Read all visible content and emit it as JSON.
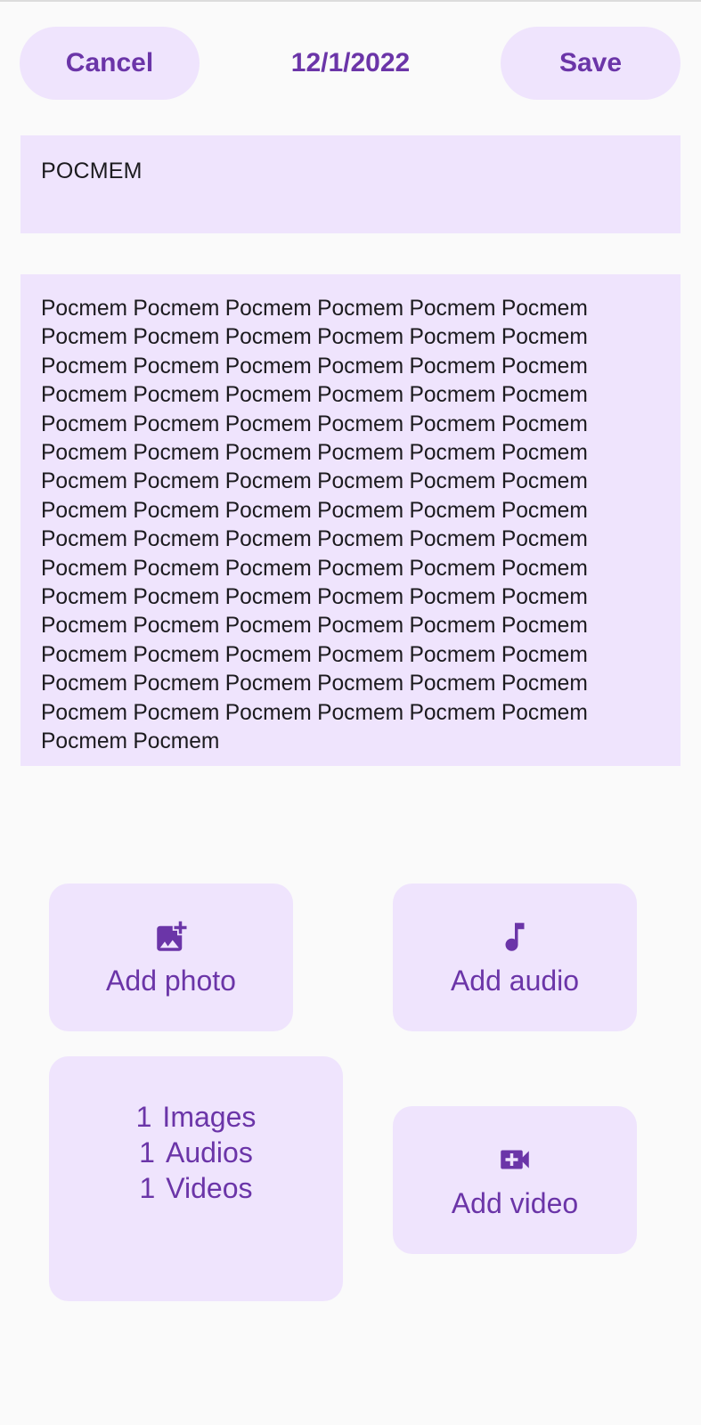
{
  "header": {
    "cancel_label": "Cancel",
    "date": "12/1/2022",
    "save_label": "Save"
  },
  "note": {
    "title": "POCMEM",
    "body_lines": [
      "Pocmem Pocmem Pocmem Pocmem Pocmem Pocmem",
      "Pocmem Pocmem Pocmem Pocmem Pocmem Pocmem",
      "Pocmem Pocmem Pocmem Pocmem Pocmem Pocmem",
      "Pocmem Pocmem Pocmem Pocmem Pocmem Pocmem",
      "Pocmem Pocmem Pocmem Pocmem Pocmem Pocmem",
      "Pocmem Pocmem Pocmem Pocmem Pocmem Pocmem",
      "Pocmem Pocmem Pocmem Pocmem Pocmem Pocmem",
      "Pocmem Pocmem Pocmem Pocmem Pocmem Pocmem",
      "Pocmem Pocmem Pocmem Pocmem Pocmem Pocmem",
      "Pocmem Pocmem Pocmem Pocmem Pocmem Pocmem",
      "Pocmem Pocmem Pocmem Pocmem Pocmem Pocmem",
      "Pocmem Pocmem Pocmem Pocmem Pocmem Pocmem",
      "Pocmem Pocmem Pocmem Pocmem Pocmem Pocmem",
      "Pocmem Pocmem Pocmem Pocmem Pocmem Pocmem",
      "Pocmem Pocmem Pocmem Pocmem Pocmem Pocmem",
      "Pocmem Pocmem"
    ]
  },
  "actions": {
    "add_photo": {
      "label": "Add photo",
      "icon": "add-photo-icon"
    },
    "add_audio": {
      "label": "Add audio",
      "icon": "music-note-icon"
    },
    "add_video": {
      "label": "Add video",
      "icon": "video-call-icon"
    }
  },
  "attachments": [
    {
      "count": "1",
      "label": "Images"
    },
    {
      "count": "1",
      "label": "Audios"
    },
    {
      "count": "1",
      "label": "Videos"
    }
  ],
  "colors": {
    "background": "#fafafa",
    "surface": "#efe4fd",
    "accent": "#6b35a8",
    "text": "#1c1b1f"
  }
}
